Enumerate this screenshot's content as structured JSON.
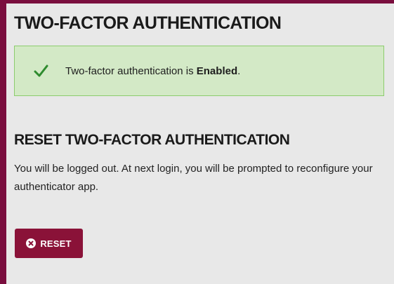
{
  "page": {
    "title": "TWO-FACTOR AUTHENTICATION"
  },
  "status": {
    "text_prefix": "Two-factor authentication is ",
    "state": "Enabled",
    "text_suffix": ".",
    "icon": "check-icon"
  },
  "reset_section": {
    "title": "RESET TWO-FACTOR AUTHENTICATION",
    "description": "You will be logged out. At next login, you will be prompted to reconfigure your authenticator app.",
    "button_label": "RESET",
    "button_icon": "x-circle-icon"
  },
  "colors": {
    "frame": "#7a0e3e",
    "panel": "#e8e8e8",
    "success_bg": "#d3e9c6",
    "success_border": "#8ccc6d",
    "check": "#2e8b2e",
    "button": "#8a1238"
  }
}
